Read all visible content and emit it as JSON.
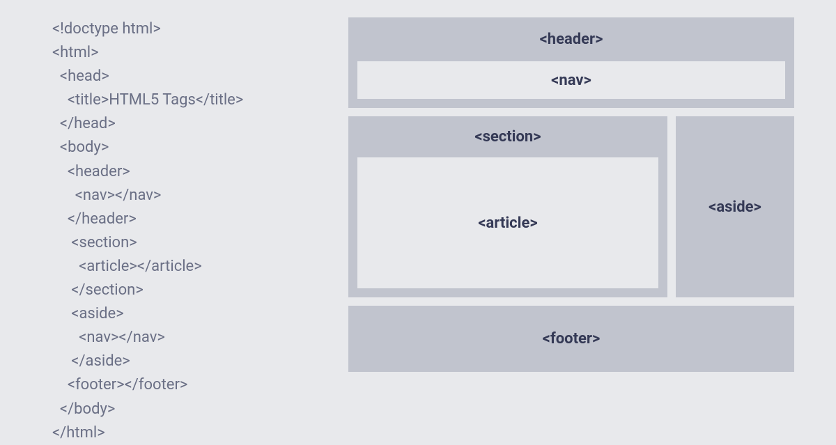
{
  "code": {
    "lines": [
      "<!doctype html>",
      "<html>",
      "  <head>",
      "    <title>HTML5 Tags</title>",
      "  </head>",
      "  <body>",
      "    <header>",
      "      <nav></nav>",
      "    </header>",
      "     <section>",
      "       <article></article>",
      "     </section>",
      "     <aside>",
      "       <nav></nav>",
      "     </aside>",
      "    <footer></footer>",
      "  </body>",
      "</html>"
    ]
  },
  "layout": {
    "header_label": "<header>",
    "nav_label": "<nav>",
    "section_label": "<section>",
    "article_label": "<article>",
    "aside_label": "<aside>",
    "footer_label": "<footer>"
  }
}
